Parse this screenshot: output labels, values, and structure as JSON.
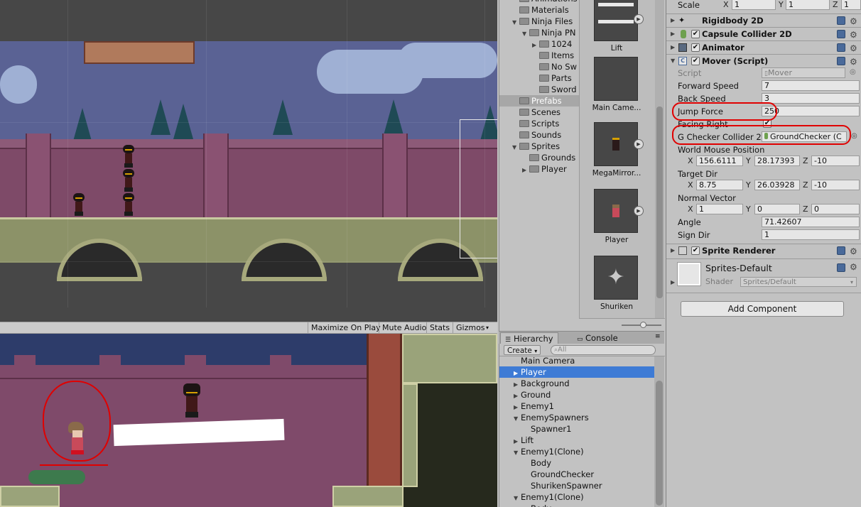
{
  "game_toolbar": {
    "maximize_on_play": "Maximize On Play",
    "mute_audio": "Mute Audio",
    "stats": "Stats",
    "gizmos": "Gizmos"
  },
  "project": {
    "tree": [
      {
        "label": "Animations",
        "indent": 0,
        "arrow": ""
      },
      {
        "label": "Materials",
        "indent": 0,
        "arrow": ""
      },
      {
        "label": "Ninja Files",
        "indent": 0,
        "arrow": "▼"
      },
      {
        "label": "Ninja PN",
        "indent": 1,
        "arrow": "▼"
      },
      {
        "label": "1024",
        "indent": 2,
        "arrow": "▶"
      },
      {
        "label": "Items",
        "indent": 2,
        "arrow": ""
      },
      {
        "label": "No Sw",
        "indent": 2,
        "arrow": ""
      },
      {
        "label": "Parts",
        "indent": 2,
        "arrow": ""
      },
      {
        "label": "Sword",
        "indent": 2,
        "arrow": ""
      },
      {
        "label": "Prefabs",
        "indent": 0,
        "arrow": "",
        "selected": true
      },
      {
        "label": "Scenes",
        "indent": 0,
        "arrow": ""
      },
      {
        "label": "Scripts",
        "indent": 0,
        "arrow": ""
      },
      {
        "label": "Sounds",
        "indent": 0,
        "arrow": ""
      },
      {
        "label": "Sprites",
        "indent": 0,
        "arrow": "▼"
      },
      {
        "label": "Grounds",
        "indent": 1,
        "arrow": ""
      },
      {
        "label": "Player",
        "indent": 1,
        "arrow": "▶"
      }
    ],
    "assets": [
      {
        "label": "Lift",
        "icon": "lift-prefab-icon",
        "play": true
      },
      {
        "label": "Main Came...",
        "icon": "camera-prefab-icon",
        "play": false
      },
      {
        "label": "MegaMirror...",
        "icon": "ninja-prefab-icon",
        "play": true
      },
      {
        "label": "Player",
        "icon": "player-prefab-icon",
        "play": true
      },
      {
        "label": "Shuriken",
        "icon": "shuriken-icon",
        "play": false
      }
    ]
  },
  "hierarchy": {
    "tabs": {
      "hierarchy": "Hierarchy",
      "console": "Console"
    },
    "create_label": "Create",
    "search_placeholder": "All",
    "rows": [
      {
        "label": "Main Camera",
        "indent": 0,
        "arrow": ""
      },
      {
        "label": "Player",
        "indent": 0,
        "arrow": "▶",
        "selected": true
      },
      {
        "label": "Background",
        "indent": 0,
        "arrow": "▶"
      },
      {
        "label": "Ground",
        "indent": 0,
        "arrow": "▶"
      },
      {
        "label": "Enemy1",
        "indent": 0,
        "arrow": "▶"
      },
      {
        "label": "EnemySpawners",
        "indent": 0,
        "arrow": "▼"
      },
      {
        "label": "Spawner1",
        "indent": 1,
        "arrow": ""
      },
      {
        "label": "Lift",
        "indent": 0,
        "arrow": "▶"
      },
      {
        "label": "Enemy1(Clone)",
        "indent": 0,
        "arrow": "▼"
      },
      {
        "label": "Body",
        "indent": 1,
        "arrow": ""
      },
      {
        "label": "GroundChecker",
        "indent": 1,
        "arrow": ""
      },
      {
        "label": "ShurikenSpawner",
        "indent": 1,
        "arrow": ""
      },
      {
        "label": "Enemy1(Clone)",
        "indent": 0,
        "arrow": "▼"
      },
      {
        "label": "Body",
        "indent": 1,
        "arrow": ""
      }
    ]
  },
  "inspector": {
    "scale": {
      "label": "Scale",
      "x": "1",
      "y": "1",
      "z": "1"
    },
    "components": {
      "rigidbody": "Rigidbody 2D",
      "capsule": "Capsule Collider 2D",
      "animator": "Animator",
      "mover": "Mover (Script)",
      "sprite_renderer": "Sprite Renderer"
    },
    "mover": {
      "script_label": "Script",
      "script_value": "Mover",
      "forward_speed_label": "Forward Speed",
      "forward_speed": "7",
      "back_speed_label": "Back Speed",
      "back_speed": "3",
      "jump_force_label": "Jump Force",
      "jump_force": "250",
      "facing_right_label": "Facing Right",
      "facing_right_check": "✔",
      "g_checker_label": "G Checker Collider 2",
      "g_checker_value": "GroundChecker (C",
      "world_mouse_label": "World Mouse Position",
      "world_mouse": {
        "x": "156.6111",
        "y": "28.17393",
        "z": "-10"
      },
      "target_dir_label": "Target Dir",
      "target_dir": {
        "x": "8.75",
        "y": "26.03928",
        "z": "-10"
      },
      "normal_vector_label": "Normal Vector",
      "normal_vector": {
        "x": "1",
        "y": "0",
        "z": "0"
      },
      "angle_label": "Angle",
      "angle": "71.42607",
      "sign_dir_label": "Sign Dir",
      "sign_dir": "1"
    },
    "material": {
      "name": "Sprites-Default",
      "shader_label": "Shader",
      "shader_value": "Sprites/Default"
    },
    "add_component": "Add Component",
    "axes": {
      "x": "X",
      "y": "Y",
      "z": "Z"
    }
  },
  "colors": {
    "selection": "#3e7bd5",
    "annotation_red": "#e00000",
    "panel_bg": "#c2c2c2"
  }
}
